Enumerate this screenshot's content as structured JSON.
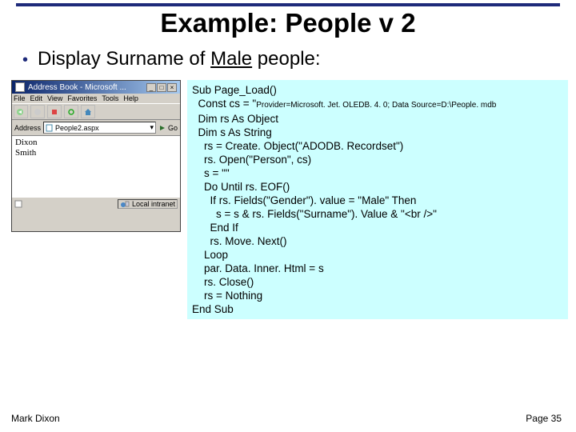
{
  "title": "Example: People v 2",
  "bullet": {
    "prefix": "Display Surname of ",
    "underlined": "Male",
    "suffix": " people:"
  },
  "browser": {
    "titlebar": "Address Book - Microsoft ...",
    "menus": [
      "File",
      "Edit",
      "View",
      "Favorites",
      "Tools",
      "Help"
    ],
    "address_label": "Address",
    "address_value": "People2.aspx",
    "go_label": "Go",
    "names": [
      "Dixon",
      "Smith"
    ],
    "status": "Local intranet"
  },
  "code": {
    "l0": "Sub Page_Load()",
    "l1": "  Const cs = \"",
    "l1b": "Provider=Microsoft. Jet. OLEDB. 4. 0; Data Source=D:\\People. mdb",
    "l2": "  Dim rs As Object",
    "l3": "  Dim s As String",
    "l4": "    rs = Create. Object(\"ADODB. Recordset\")",
    "l5": "    rs. Open(\"Person\", cs)",
    "l6": "    s = \"\"",
    "l7": "    Do Until rs. EOF()",
    "l8": "      If rs. Fields(\"Gender\"). value = \"Male\" Then",
    "l9": "        s = s & rs. Fields(\"Surname\"). Value & \"<br />\"",
    "l10": "      End If",
    "l11": "      rs. Move. Next()",
    "l12": "    Loop",
    "l13": "    par. Data. Inner. Html = s",
    "l14": "    rs. Close()",
    "l15": "    rs = Nothing",
    "l16": "End Sub"
  },
  "footer": {
    "left": "Mark Dixon",
    "right": "Page 35"
  }
}
